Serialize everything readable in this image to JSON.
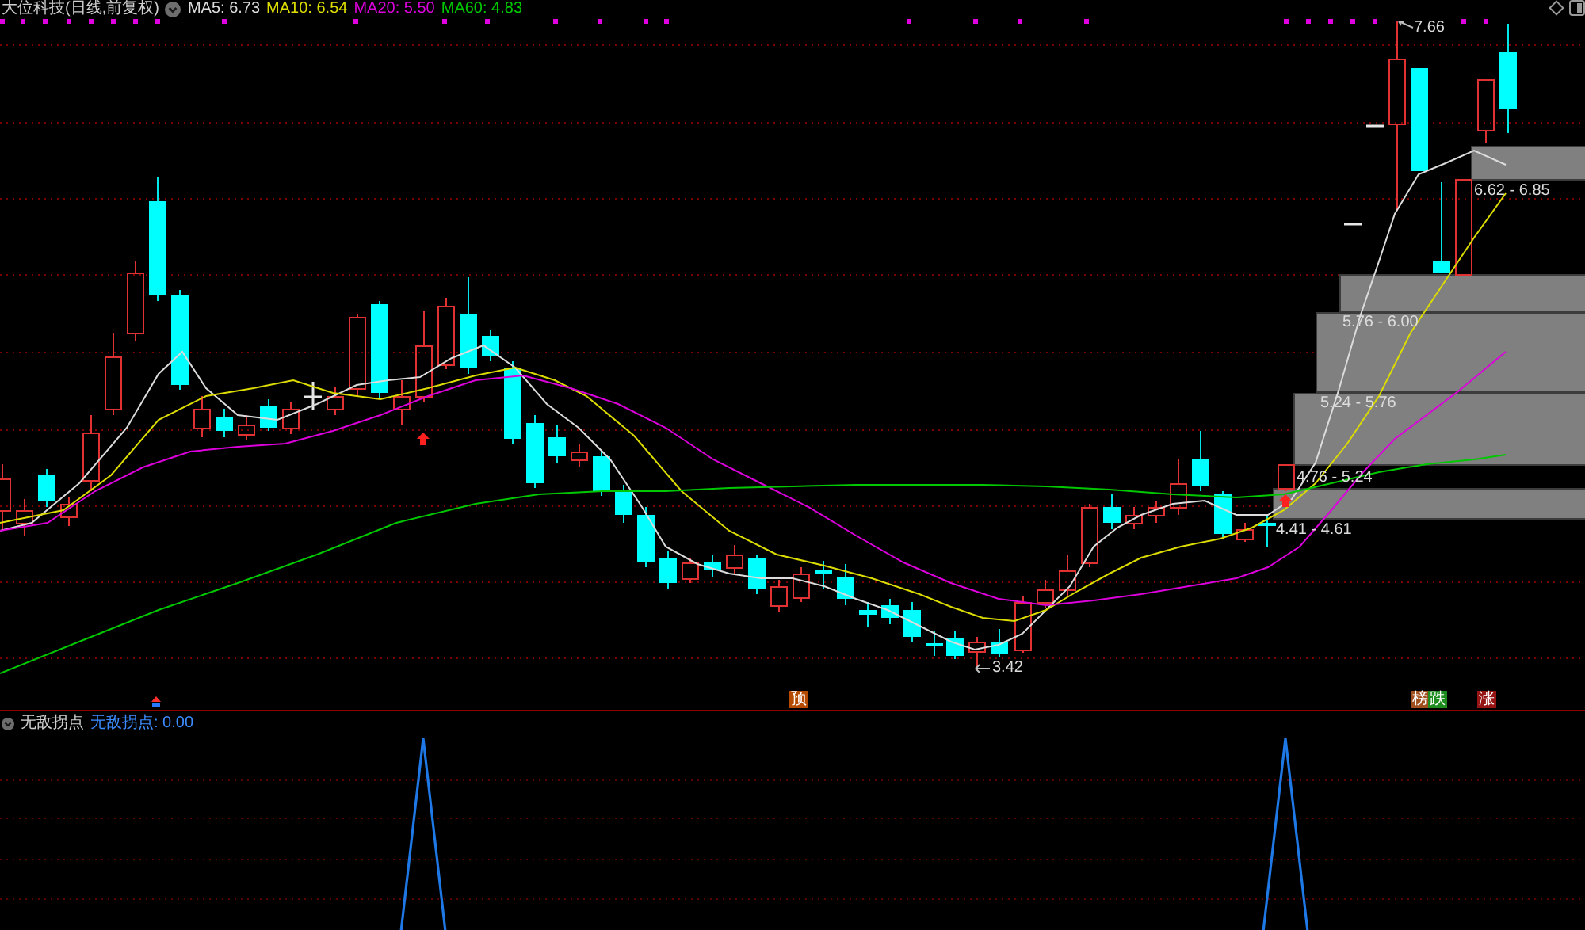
{
  "header": {
    "title": "大位科技(日线,前复权)",
    "moving_averages": [
      {
        "label": "MA5: 6.73",
        "color": "#dcdcdc"
      },
      {
        "label": "MA10: 6.54",
        "color": "#dcdc00"
      },
      {
        "label": "MA20: 5.50",
        "color": "#dc00dc"
      },
      {
        "label": "MA60: 4.83",
        "color": "#00c800"
      }
    ]
  },
  "price_chart": {
    "high_label": "7.66",
    "low_label": "3.42",
    "chip_ranges": [
      "6.62 - 6.85",
      "5.76 - 6.00",
      "5.24 - 5.76",
      "4.76 - 5.24",
      "4.41 - 4.61"
    ],
    "signal_badges": [
      {
        "text": "预",
        "color": "#b44b00"
      },
      {
        "text": "榜",
        "color": "#a0501e"
      },
      {
        "text": "跌",
        "color": "#1e8c1e"
      },
      {
        "text": "涨",
        "color": "#961414"
      }
    ]
  },
  "indicator_panel": {
    "name": "无敌拐点",
    "reading": "无敌拐点: 0.00"
  }
}
